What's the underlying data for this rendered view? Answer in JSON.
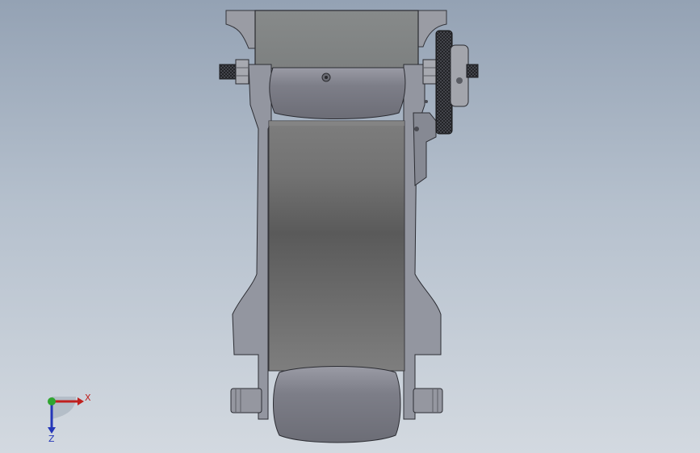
{
  "view": {
    "background_top": "#94a2b4",
    "background_bottom": "#d3d9e0",
    "part_color": "#8e919a",
    "belt_color": "#6f6f6f"
  },
  "triad": {
    "x_label": "X",
    "z_label": "Z",
    "x_color": "#c0201e",
    "y_color": "#2fa52f",
    "z_color": "#2436b8"
  }
}
